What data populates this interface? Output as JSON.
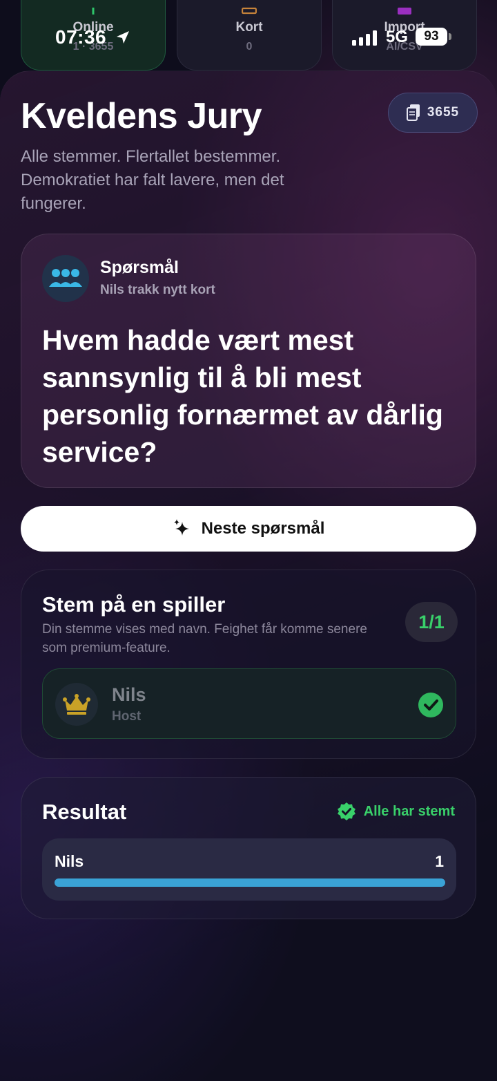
{
  "status_bar": {
    "time": "07:36",
    "network": "5G",
    "battery": "93"
  },
  "top_tiles": [
    {
      "title": "Online",
      "sub": "1 · 3655"
    },
    {
      "title": "Kort",
      "sub": "0"
    },
    {
      "title": "Import",
      "sub": "AI/CSV"
    }
  ],
  "header": {
    "title": "Kveldens Jury",
    "subtitle": "Alle stemmer. Flertallet bestemmer. Demokratiet har falt lavere, men det fungerer.",
    "card_count": "3655"
  },
  "question": {
    "label": "Spørsmål",
    "drawn_by": "Nils trakk nytt kort",
    "text": "Hvem hadde vært mest sannsynlig til å bli mest personlig fornærmet av dårlig service?"
  },
  "next_button": {
    "label": "Neste spørsmål"
  },
  "vote": {
    "title": "Stem på en spiller",
    "description": "Din stemme vises med navn. Feighet får komme senere som premium-feature.",
    "count": "1/1",
    "players": [
      {
        "name": "Nils",
        "role": "Host",
        "selected": true
      }
    ]
  },
  "result": {
    "title": "Resultat",
    "status": "Alle har stemt",
    "rows": [
      {
        "name": "Nils",
        "votes": "1",
        "fraction": 1.0
      }
    ]
  },
  "colors": {
    "accent_green": "#39d06a",
    "bar_blue": "#3aa2d6",
    "crown_gold": "#c9a227"
  }
}
